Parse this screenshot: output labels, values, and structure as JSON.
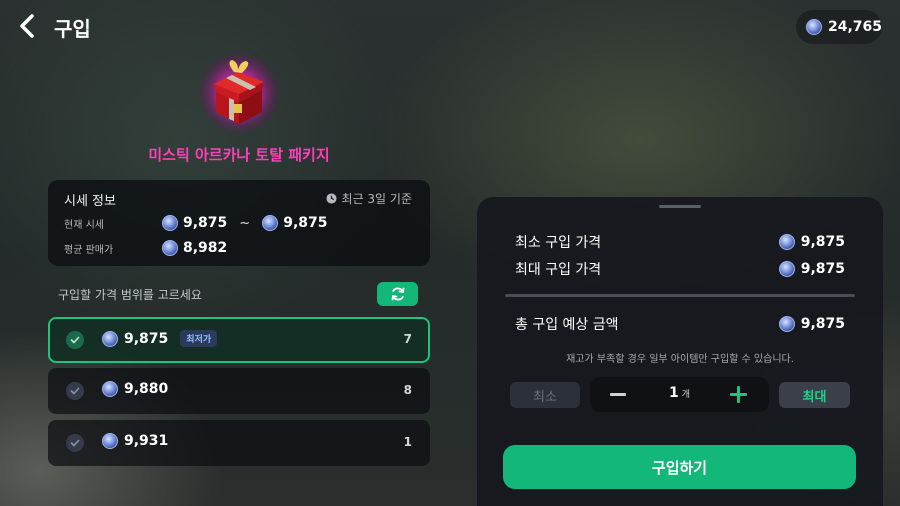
{
  "header": {
    "title": "구입",
    "back_icon": "chevron-left-icon",
    "balance": "24,765"
  },
  "product": {
    "name": "미스틱 아르카나 토탈 패키지",
    "icon": "red-gift-box-icon",
    "name_color": "#ff3fb6"
  },
  "price_info": {
    "title": "시세 정보",
    "period": "최근 3일 기준",
    "current_label": "현재 시세",
    "current_min": "9,875",
    "separator": "~",
    "current_max": "9,875",
    "avg_label": "평균 판매가",
    "avg_value": "8,982"
  },
  "range": {
    "label": "구입할 가격 범위를 고르세요",
    "refresh_icon": "refresh-icon"
  },
  "options": [
    {
      "price": "9,875",
      "badge": "최저가",
      "qty": "7",
      "selected": true
    },
    {
      "price": "9,880",
      "badge": "",
      "qty": "8",
      "selected": false
    },
    {
      "price": "9,931",
      "badge": "",
      "qty": "1",
      "selected": false
    }
  ],
  "summary": {
    "min_label": "최소 구입 가격",
    "min_value": "9,875",
    "max_label": "최대 구입 가격",
    "max_value": "9,875",
    "total_label": "총 구입 예상 금액",
    "total_value": "9,875",
    "notice": "재고가 부족할 경우 일부 아이템만 구입할 수 있습니다."
  },
  "quantity": {
    "min_label": "최소",
    "value": "1",
    "unit": "개",
    "max_label": "최대"
  },
  "buy_label": "구입하기",
  "colors": {
    "accent": "#14b77a",
    "selected_border": "#1fc27f",
    "coin": "#5f7bd0"
  }
}
